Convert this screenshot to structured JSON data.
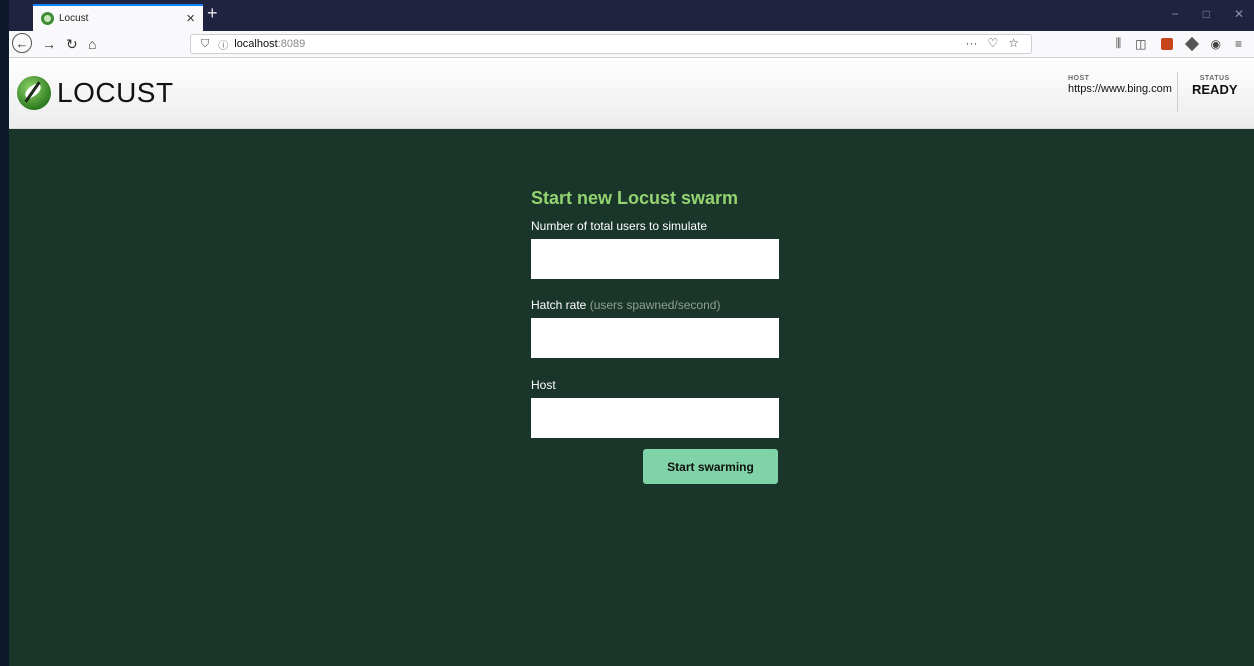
{
  "browser": {
    "tab_title": "Locust",
    "tab_close": "×",
    "new_tab": "+",
    "window_controls": {
      "minimize": "−",
      "maximize": "□",
      "close": "✕"
    },
    "url_host": "localhost",
    "url_port": ":8089",
    "icons": [
      "back-icon",
      "forward-icon",
      "reload-icon",
      "home-icon",
      "shield-icon",
      "info-icon",
      "more-icon",
      "pocket-icon",
      "bookmark-star-icon",
      "library-icon",
      "sidebar-icon",
      "extension-icon",
      "account-icon",
      "menu-icon"
    ]
  },
  "header": {
    "logo_text": "LOCUST",
    "host_label": "HOST",
    "host_value": "https://www.bing.com",
    "status_label": "STATUS",
    "status_value": "READY"
  },
  "form": {
    "title": "Start new Locust swarm",
    "users_label": "Number of total users to simulate",
    "users_value": "",
    "hatch_label": "Hatch rate",
    "hatch_hint": "(users spawned/second)",
    "hatch_value": "",
    "host_label": "Host",
    "host_value": "",
    "submit_label": "Start swarming"
  },
  "colors": {
    "background": "#1a362b",
    "title": "#93d36f",
    "button": "#7fd3a6",
    "tabstrip": "#202340"
  }
}
